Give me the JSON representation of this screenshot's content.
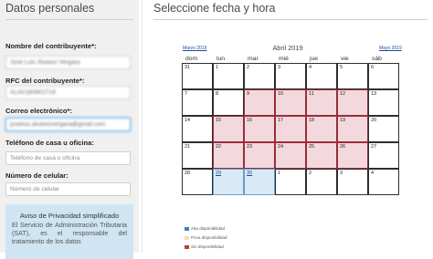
{
  "left": {
    "title": "Datos personales",
    "fields": [
      {
        "label": "Nombre del contribuyente*:",
        "value": "José Luis Álvarez Vergara",
        "placeholder": ""
      },
      {
        "label": "RFC del contribuyente*:",
        "value": "ALAV180901T19",
        "placeholder": ""
      },
      {
        "label": "Correo electrónico*:",
        "value": "joseluis.alvarezvergara@gmail.com",
        "placeholder": ""
      },
      {
        "label": "Teléfono de casa u oficina:",
        "value": "",
        "placeholder": "Teléfono de casa u oficina"
      },
      {
        "label": "Número de celular:",
        "value": "",
        "placeholder": "Número de celular"
      }
    ],
    "privacy": {
      "title": "Aviso de Privacidad simplificado",
      "text": "El Servicio de Administración Tributaria (SAT), es el responsable del tratamiento de los datos"
    }
  },
  "right": {
    "title": "Seleccione fecha y hora",
    "calendar": {
      "prev_label": "Marzo 2019",
      "next_label": "Mayo 2019",
      "month_label": "Abril 2019",
      "day_names": [
        "dom",
        "lun",
        "mar",
        "mié",
        "jue",
        "vie",
        "sáb"
      ],
      "weeks": [
        [
          {
            "d": "31",
            "s": "none"
          },
          {
            "d": "1",
            "s": "none"
          },
          {
            "d": "2",
            "s": "none"
          },
          {
            "d": "3",
            "s": "none"
          },
          {
            "d": "4",
            "s": "none"
          },
          {
            "d": "5",
            "s": "none"
          },
          {
            "d": "6",
            "s": "none"
          }
        ],
        [
          {
            "d": "7",
            "s": "none"
          },
          {
            "d": "8",
            "s": "none"
          },
          {
            "d": "9",
            "s": "unavailable"
          },
          {
            "d": "10",
            "s": "unavailable"
          },
          {
            "d": "11",
            "s": "unavailable"
          },
          {
            "d": "12",
            "s": "unavailable"
          },
          {
            "d": "13",
            "s": "none"
          }
        ],
        [
          {
            "d": "14",
            "s": "none"
          },
          {
            "d": "15",
            "s": "unavailable"
          },
          {
            "d": "16",
            "s": "unavailable"
          },
          {
            "d": "17",
            "s": "unavailable"
          },
          {
            "d": "18",
            "s": "unavailable"
          },
          {
            "d": "19",
            "s": "unavailable"
          },
          {
            "d": "20",
            "s": "none"
          }
        ],
        [
          {
            "d": "21",
            "s": "none"
          },
          {
            "d": "22",
            "s": "unavailable"
          },
          {
            "d": "23",
            "s": "unavailable"
          },
          {
            "d": "24",
            "s": "unavailable"
          },
          {
            "d": "25",
            "s": "unavailable"
          },
          {
            "d": "26",
            "s": "unavailable"
          },
          {
            "d": "27",
            "s": "none"
          }
        ],
        [
          {
            "d": "28",
            "s": "none"
          },
          {
            "d": "29",
            "s": "high"
          },
          {
            "d": "30",
            "s": "high"
          },
          {
            "d": "1",
            "s": "none"
          },
          {
            "d": "2",
            "s": "none"
          },
          {
            "d": "3",
            "s": "none"
          },
          {
            "d": "4",
            "s": "none"
          }
        ]
      ]
    },
    "legend": [
      {
        "label": "Alta disponibilidad",
        "color": "#3f7fbf"
      },
      {
        "label": "Poca disponibilidad",
        "color": "#f2dfb0"
      },
      {
        "label": "Sin disponibilidad",
        "color": "#c0392b"
      }
    ]
  }
}
